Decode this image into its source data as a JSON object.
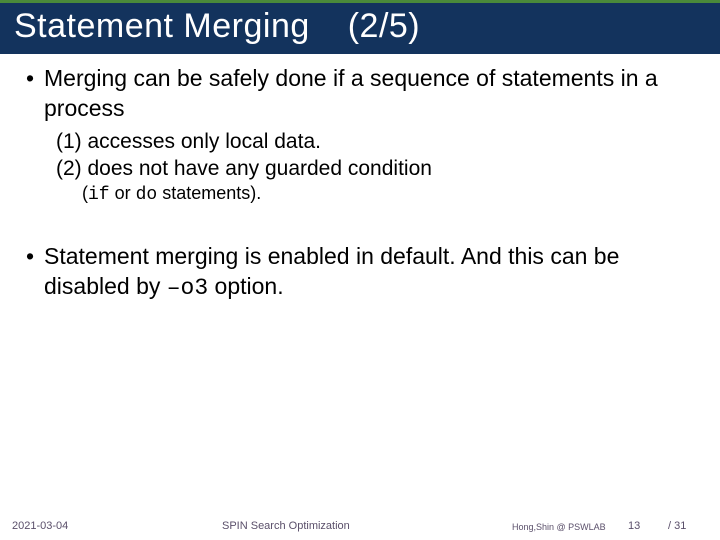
{
  "title": {
    "main": "Statement Merging",
    "part": "(2/5)"
  },
  "body": {
    "b1": "Merging can be safely done if a sequence of statements in a process",
    "s1": "(1) accesses only local data.",
    "s2": "(2) does not have any guarded condition",
    "ss_open": "(",
    "ss_if": "if",
    "ss_mid": " or ",
    "ss_do": "do",
    "ss_close": " statements).",
    "b2a": "Statement merging is enabled in default. And this can be disabled by ",
    "b2_code": "–o3",
    "b2b": "  option."
  },
  "footer": {
    "date": "2021-03-04",
    "center": "SPIN Search Optimization",
    "author": "Hong,Shin @ PSWLAB",
    "page": "13",
    "total": "/ 31"
  }
}
